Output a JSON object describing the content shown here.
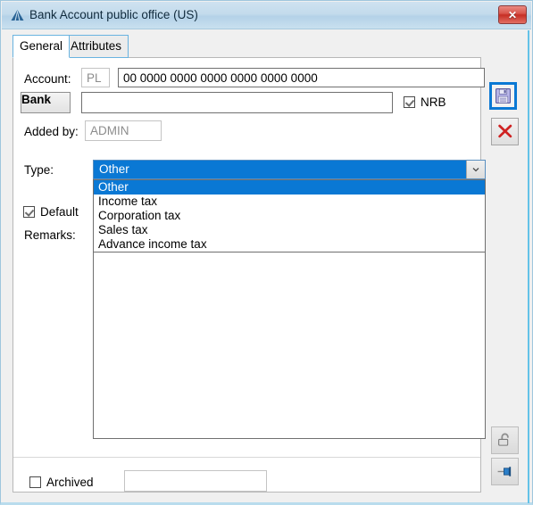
{
  "window": {
    "title": "Bank Account public office (US)",
    "icon": "mountain-logo-icon",
    "close_label": "✕"
  },
  "tabs": [
    {
      "label": "General",
      "active": true
    },
    {
      "label": "Attributes",
      "active": false
    }
  ],
  "form": {
    "account": {
      "label": "Account:",
      "prefix_value": "PL",
      "number_value": "00 0000 0000 0000 0000 0000 0000"
    },
    "bank": {
      "button_label": "Bank",
      "value": "",
      "placeholder": ""
    },
    "nrb": {
      "label": "NRB",
      "checked": true
    },
    "added_by": {
      "label": "Added by:",
      "value": "ADMIN"
    },
    "type": {
      "label": "Type:",
      "selected": "Other",
      "options": [
        "Other",
        "Income tax",
        "Corporation tax",
        "Sales tax",
        "Advance income tax"
      ],
      "highlight_color": "#0a78d4"
    },
    "default": {
      "label": "Default",
      "checked": true
    },
    "remarks": {
      "label": "Remarks:",
      "value": "",
      "placeholder": ""
    },
    "archived": {
      "label": "Archived",
      "checked": false
    },
    "archived_field": {
      "value": "",
      "placeholder": ""
    }
  },
  "toolbar": {
    "save": {
      "name": "save-button",
      "icon": "floppy-disk-icon",
      "focused": true
    },
    "cancel": {
      "name": "cancel-button",
      "icon": "red-x-icon",
      "focused": false
    },
    "unlock": {
      "name": "unlock-button",
      "icon": "open-padlock-icon",
      "disabled": true
    },
    "pin": {
      "name": "pin-button",
      "icon": "pin-icon",
      "disabled": true
    }
  }
}
